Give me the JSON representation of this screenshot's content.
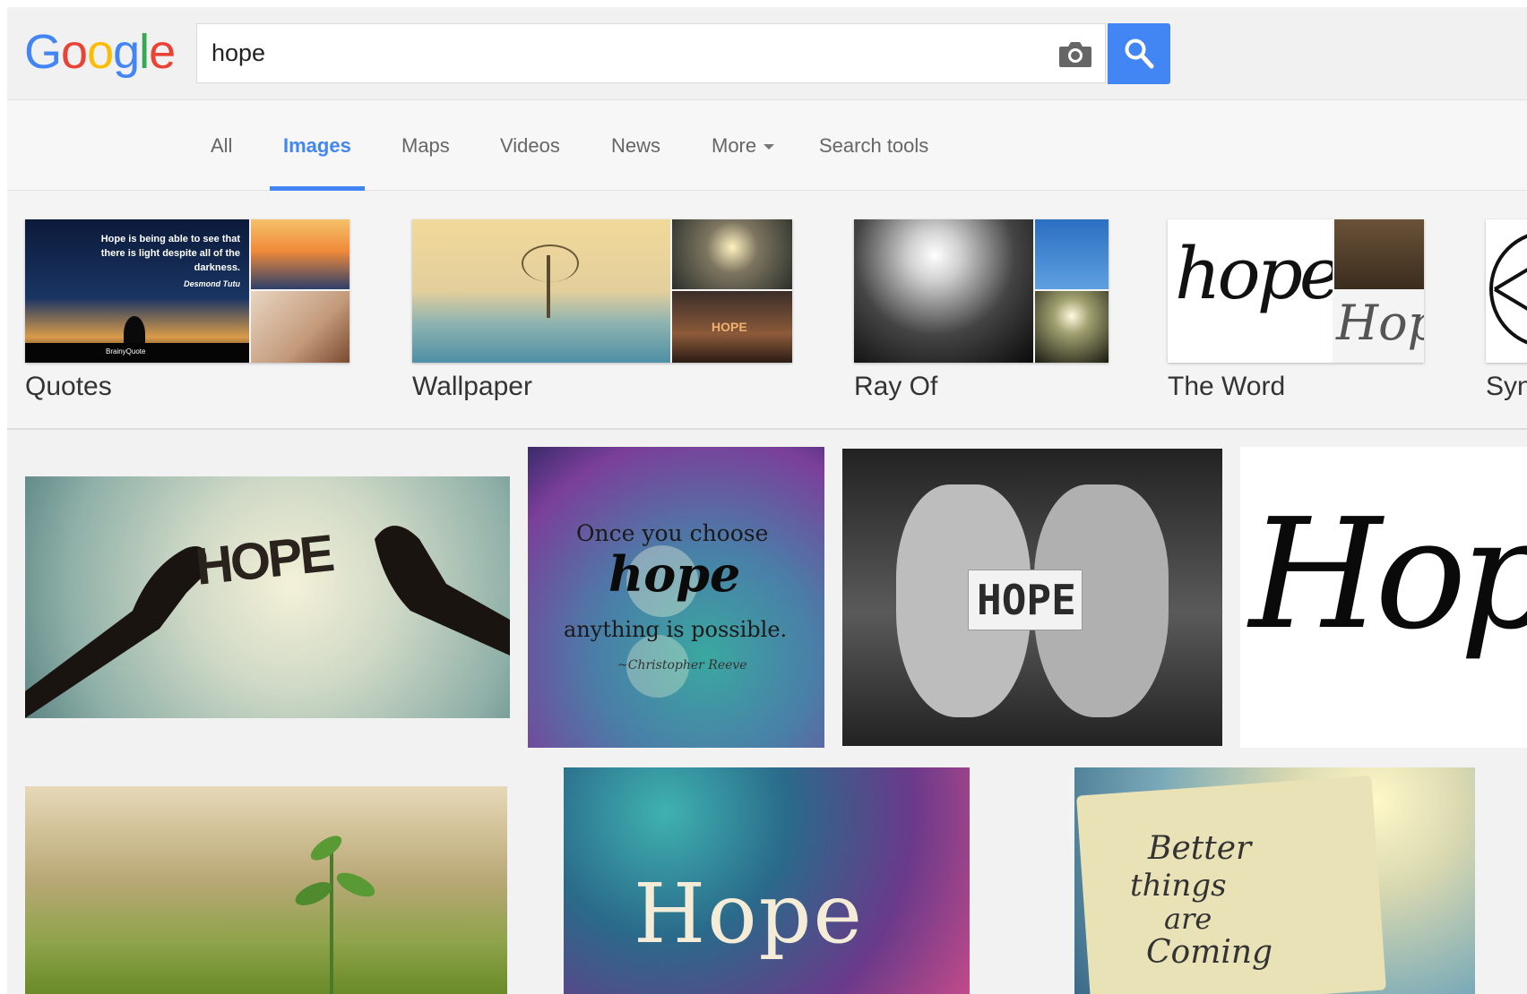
{
  "logo": {
    "letters": [
      "G",
      "o",
      "o",
      "g",
      "l",
      "e"
    ],
    "colors": [
      "#4285f4",
      "#ea4335",
      "#fbbc05",
      "#4285f4",
      "#34a853",
      "#ea4335"
    ]
  },
  "search": {
    "query": "hope"
  },
  "tabs": {
    "all": "All",
    "images": "Images",
    "maps": "Maps",
    "videos": "Videos",
    "news": "News",
    "more": "More",
    "search_tools": "Search tools"
  },
  "related": {
    "quotes": {
      "label": "Quotes",
      "quote": "Hope is being able to see that there is light despite all of the darkness.",
      "author": "Desmond Tutu",
      "brand": "BrainyQuote"
    },
    "wallpaper": {
      "label": "Wallpaper",
      "inner_text": "HOPE"
    },
    "ray_of": {
      "label": "Ray Of"
    },
    "the_word": {
      "label": "The Word",
      "script_word": "hope",
      "script_word_2": "Hope"
    },
    "symbol": {
      "label": "Syn"
    }
  },
  "results": {
    "r1": {
      "text": "HOPE"
    },
    "r2": {
      "line1": "Once you choose",
      "line2": "hope",
      "line3": "anything is possible.",
      "signature": "~Christopher Reeve"
    },
    "r3": {
      "text": "HOPE"
    },
    "r4": {
      "text": "Hope"
    },
    "r6": {
      "text": "Hope"
    },
    "r7": {
      "line1": "Better",
      "line2": "things",
      "line3": "are",
      "line4": "Coming"
    }
  },
  "colors": {
    "accent": "#4285f4",
    "tab_text": "#666666",
    "label_text": "#333333"
  }
}
